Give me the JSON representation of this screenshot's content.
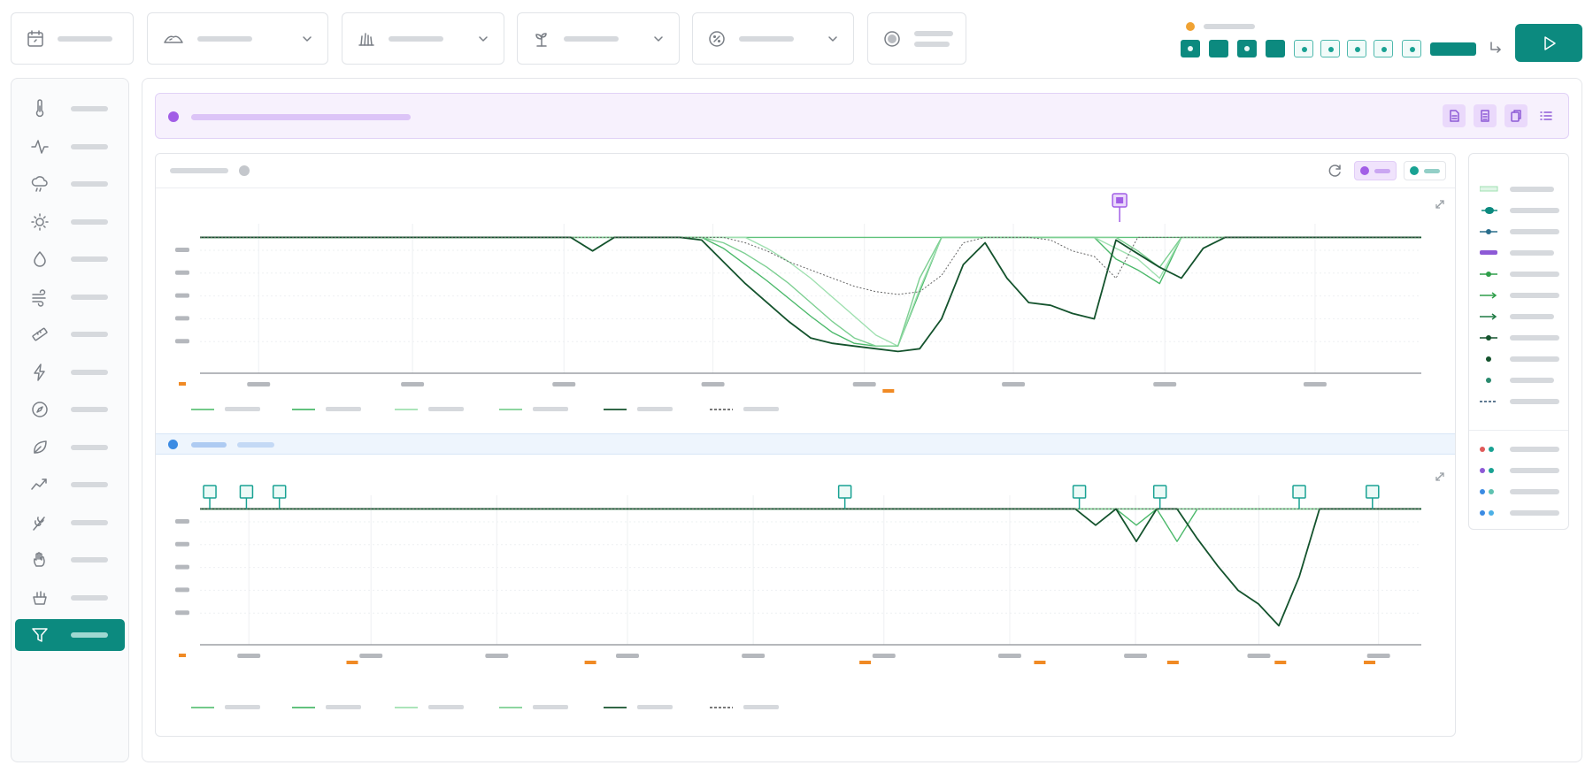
{
  "toolbar": {
    "filters": [
      {
        "id": "date",
        "icon": "calendar-icon"
      },
      {
        "id": "weather",
        "icon": "cloud-hills-icon"
      },
      {
        "id": "crop",
        "icon": "grass-icon"
      },
      {
        "id": "plant",
        "icon": "seedling-icon"
      },
      {
        "id": "percent",
        "icon": "percent-circle-icon"
      },
      {
        "id": "toggle",
        "icon": "radio-icon"
      }
    ],
    "status_dot_color": "#f0a233",
    "accent": "#0c8a7f",
    "steps": [
      {
        "style": "solid"
      },
      {
        "style": "solid-plain"
      },
      {
        "style": "solid"
      },
      {
        "style": "solid-plain"
      },
      {
        "style": "outline"
      },
      {
        "style": "outline"
      },
      {
        "style": "outline"
      },
      {
        "style": "outline"
      },
      {
        "style": "outline"
      }
    ],
    "run_icon": "play-icon"
  },
  "sidebar": {
    "items": [
      {
        "icon": "thermometer-icon"
      },
      {
        "icon": "pulse-icon"
      },
      {
        "icon": "cloud-rain-icon"
      },
      {
        "icon": "sun-icon"
      },
      {
        "icon": "droplet-icon"
      },
      {
        "icon": "wind-icon"
      },
      {
        "icon": "ruler-icon"
      },
      {
        "icon": "lightning-icon"
      },
      {
        "icon": "compass-icon"
      },
      {
        "icon": "leaf-icon"
      },
      {
        "icon": "trend-icon"
      },
      {
        "icon": "wheat-icon"
      },
      {
        "icon": "hand-icon"
      },
      {
        "icon": "planter-icon"
      },
      {
        "icon": "filter-icon",
        "active": true
      }
    ]
  },
  "banner": {
    "color": "#a25ee6",
    "actions": [
      {
        "icon": "document-icon"
      },
      {
        "icon": "document-lines-icon"
      },
      {
        "icon": "copy-icon"
      },
      {
        "icon": "list-icon"
      }
    ]
  },
  "colors": {
    "series": [
      "#5fc27a",
      "#4cb96b",
      "#9fe0b0",
      "#7dcf92",
      "#14532d",
      "#666666"
    ],
    "marker": "#a25ee6",
    "flag": "#19a293",
    "tick_accent": "#f08a24",
    "section2": "#3b8be3"
  },
  "chart_data": [
    {
      "type": "line",
      "x": [
        0,
        1,
        2,
        3,
        4,
        5,
        6,
        7,
        8,
        9,
        10,
        11,
        12,
        13,
        14,
        15,
        16,
        17,
        18,
        19,
        20,
        21,
        22,
        23,
        24,
        25,
        26,
        27,
        28,
        29,
        30,
        31,
        32,
        33,
        34,
        35,
        36,
        37,
        38,
        39,
        40,
        41,
        42,
        43,
        44,
        45,
        46,
        47,
        48,
        49,
        50,
        51,
        52,
        53,
        54,
        55,
        56
      ],
      "series": [
        {
          "values": [
            100,
            100,
            100,
            100,
            100,
            100,
            100,
            100,
            100,
            100,
            100,
            100,
            100,
            100,
            100,
            100,
            100,
            100,
            100,
            100,
            100,
            100,
            100,
            100,
            100,
            100,
            100,
            100,
            100,
            100,
            100,
            100,
            100,
            100,
            100,
            100,
            100,
            100,
            100,
            100,
            100,
            100,
            100,
            100,
            100,
            100,
            100,
            100,
            100,
            100,
            100,
            100,
            100,
            100,
            100,
            100,
            100
          ]
        },
        {
          "values": [
            100,
            100,
            100,
            100,
            100,
            100,
            100,
            100,
            100,
            100,
            100,
            100,
            100,
            100,
            100,
            100,
            100,
            100,
            100,
            100,
            100,
            100,
            100,
            100,
            92,
            80,
            68,
            55,
            42,
            30,
            22,
            20,
            20,
            60,
            100,
            100,
            100,
            100,
            100,
            100,
            100,
            100,
            84,
            76,
            66,
            100,
            100,
            100,
            100,
            100,
            100,
            100,
            100,
            100,
            100,
            100,
            100
          ]
        },
        {
          "values": [
            100,
            100,
            100,
            100,
            100,
            100,
            100,
            100,
            100,
            100,
            100,
            100,
            100,
            100,
            100,
            100,
            100,
            100,
            100,
            100,
            100,
            100,
            100,
            100,
            100,
            100,
            92,
            82,
            70,
            56,
            42,
            28,
            20,
            62,
            100,
            100,
            100,
            100,
            100,
            100,
            100,
            100,
            92,
            84,
            70,
            100,
            100,
            100,
            100,
            100,
            100,
            100,
            100,
            100,
            100,
            100,
            100
          ]
        },
        {
          "values": [
            100,
            100,
            100,
            100,
            100,
            100,
            100,
            100,
            100,
            100,
            100,
            100,
            100,
            100,
            100,
            100,
            100,
            100,
            100,
            100,
            100,
            100,
            100,
            100,
            96,
            88,
            78,
            66,
            52,
            38,
            26,
            20,
            20,
            70,
            100,
            100,
            100,
            100,
            100,
            100,
            100,
            100,
            100,
            90,
            78,
            100,
            100,
            100,
            100,
            100,
            100,
            100,
            100,
            100,
            100,
            100,
            100
          ]
        },
        {
          "values": [
            100,
            100,
            100,
            100,
            100,
            100,
            100,
            100,
            100,
            100,
            100,
            100,
            100,
            100,
            100,
            100,
            100,
            100,
            90,
            100,
            100,
            100,
            100,
            98,
            82,
            66,
            52,
            38,
            26,
            22,
            20,
            18,
            16,
            18,
            40,
            80,
            96,
            70,
            52,
            50,
            44,
            40,
            98,
            88,
            78,
            70,
            92,
            100,
            100,
            100,
            100,
            100,
            100,
            100,
            100,
            100,
            100
          ]
        },
        {
          "values": [
            100,
            100,
            100,
            100,
            100,
            100,
            100,
            100,
            100,
            100,
            100,
            100,
            100,
            100,
            100,
            100,
            100,
            100,
            100,
            100,
            100,
            100,
            100,
            100,
            100,
            96,
            90,
            82,
            76,
            70,
            64,
            60,
            58,
            60,
            72,
            96,
            100,
            100,
            100,
            98,
            90,
            86,
            70,
            100,
            100,
            100,
            100,
            100,
            100,
            100,
            100,
            100,
            100,
            100,
            100,
            100,
            100
          ]
        }
      ],
      "ylim": [
        0,
        110
      ],
      "grid": true
    },
    {
      "type": "line",
      "x": [
        0,
        1,
        2,
        3,
        4,
        5,
        6,
        7,
        8,
        9,
        10,
        11,
        12,
        13,
        14,
        15,
        16,
        17,
        18,
        19,
        20,
        21,
        22,
        23,
        24,
        25,
        26,
        27,
        28,
        29,
        30,
        31,
        32,
        33,
        34,
        35,
        36,
        37,
        38,
        39,
        40,
        41,
        42,
        43,
        44,
        45,
        46,
        47,
        48,
        49,
        50,
        51,
        52,
        53,
        54,
        55,
        56,
        57,
        58,
        59,
        60
      ],
      "series": [
        {
          "values": [
            100,
            100,
            100,
            100,
            100,
            100,
            100,
            100,
            100,
            100,
            100,
            100,
            100,
            100,
            100,
            100,
            100,
            100,
            100,
            100,
            100,
            100,
            100,
            100,
            100,
            100,
            100,
            100,
            100,
            100,
            100,
            100,
            100,
            100,
            100,
            100,
            100,
            100,
            100,
            100,
            100,
            100,
            100,
            100,
            100,
            100,
            100,
            100,
            100,
            100,
            100,
            100,
            100,
            100,
            100,
            100,
            100,
            100,
            100,
            100,
            100
          ]
        },
        {
          "values": [
            100,
            100,
            100,
            100,
            100,
            100,
            100,
            100,
            100,
            100,
            100,
            100,
            100,
            100,
            100,
            100,
            100,
            100,
            100,
            100,
            100,
            100,
            100,
            100,
            100,
            100,
            100,
            100,
            100,
            100,
            100,
            100,
            100,
            100,
            100,
            100,
            100,
            100,
            100,
            100,
            100,
            100,
            100,
            100,
            100,
            100,
            88,
            100,
            76,
            100,
            100,
            100,
            100,
            100,
            100,
            100,
            100,
            100,
            100,
            100,
            100
          ]
        },
        {
          "values": [
            100,
            100,
            100,
            100,
            100,
            100,
            100,
            100,
            100,
            100,
            100,
            100,
            100,
            100,
            100,
            100,
            100,
            100,
            100,
            100,
            100,
            100,
            100,
            100,
            100,
            100,
            100,
            100,
            100,
            100,
            100,
            100,
            100,
            100,
            100,
            100,
            100,
            100,
            100,
            100,
            100,
            100,
            100,
            100,
            100,
            100,
            100,
            100,
            100,
            100,
            100,
            100,
            100,
            100,
            100,
            100,
            100,
            100,
            100,
            100,
            100
          ]
        },
        {
          "values": [
            100,
            100,
            100,
            100,
            100,
            100,
            100,
            100,
            100,
            100,
            100,
            100,
            100,
            100,
            100,
            100,
            100,
            100,
            100,
            100,
            100,
            100,
            100,
            100,
            100,
            100,
            100,
            100,
            100,
            100,
            100,
            100,
            100,
            100,
            100,
            100,
            100,
            100,
            100,
            100,
            100,
            100,
            100,
            100,
            100,
            100,
            100,
            100,
            100,
            100,
            100,
            100,
            100,
            100,
            100,
            100,
            100,
            100,
            100,
            100,
            100
          ]
        },
        {
          "values": [
            100,
            100,
            100,
            100,
            100,
            100,
            100,
            100,
            100,
            100,
            100,
            100,
            100,
            100,
            100,
            100,
            100,
            100,
            100,
            100,
            100,
            100,
            100,
            100,
            100,
            100,
            100,
            100,
            100,
            100,
            100,
            100,
            100,
            100,
            100,
            100,
            100,
            100,
            100,
            100,
            100,
            100,
            100,
            100,
            88,
            100,
            76,
            100,
            100,
            78,
            58,
            40,
            30,
            14,
            50,
            100,
            100,
            100,
            100,
            100,
            100
          ]
        },
        {
          "values": [
            100,
            100,
            100,
            100,
            100,
            100,
            100,
            100,
            100,
            100,
            100,
            100,
            100,
            100,
            100,
            100,
            100,
            100,
            100,
            100,
            100,
            100,
            100,
            100,
            100,
            100,
            100,
            100,
            100,
            100,
            100,
            100,
            100,
            100,
            100,
            100,
            100,
            100,
            100,
            100,
            100,
            100,
            100,
            100,
            100,
            100,
            100,
            100,
            100,
            100,
            100,
            100,
            100,
            100,
            100,
            100,
            100,
            100,
            100,
            100,
            100
          ]
        }
      ],
      "ylim": [
        0,
        110
      ],
      "grid": true
    }
  ]
}
